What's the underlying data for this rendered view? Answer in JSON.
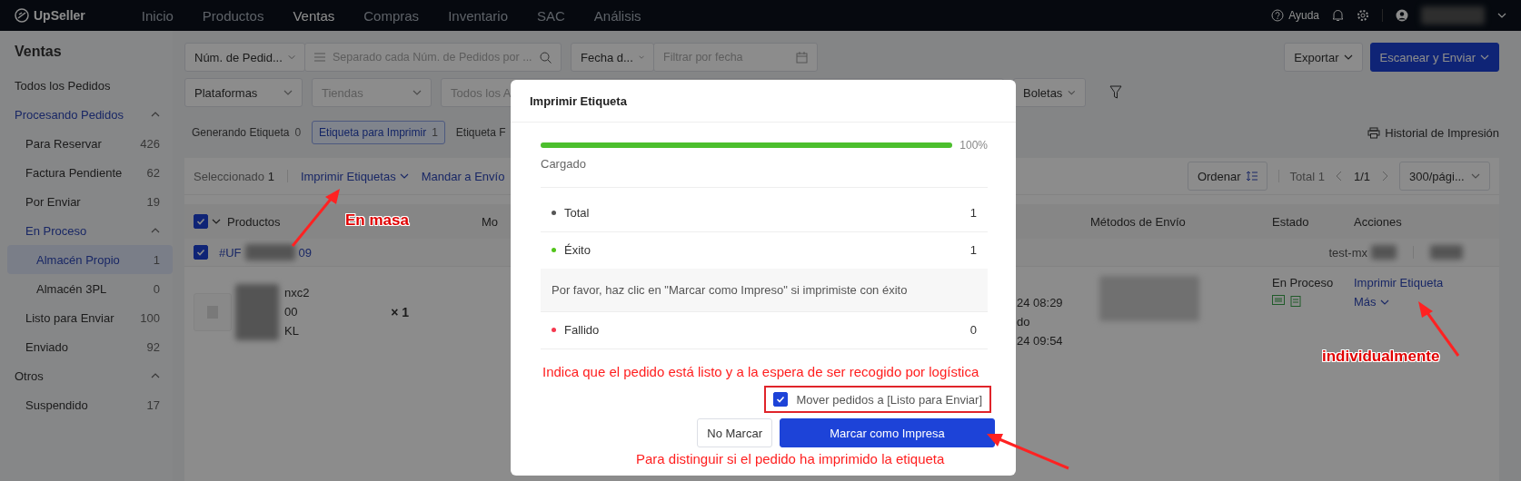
{
  "top_nav": {
    "logo": "UpSeller",
    "items": [
      {
        "label": "Inicio",
        "selected": false
      },
      {
        "label": "Productos",
        "selected": false
      },
      {
        "label": "Ventas",
        "selected": true
      },
      {
        "label": "Compras",
        "selected": false
      },
      {
        "label": "Inventario",
        "selected": false
      },
      {
        "label": "SAC",
        "selected": false
      },
      {
        "label": "Análisis",
        "selected": false
      }
    ],
    "help": "Ayuda"
  },
  "sidebar": {
    "title": "Ventas",
    "items": [
      {
        "label": "Todos los Pedidos",
        "selected": false
      },
      {
        "label": "Procesando Pedidos",
        "selected": false,
        "expanded": true,
        "children": [
          {
            "label": "Para Reservar",
            "count": "426",
            "selected": false
          },
          {
            "label": "Factura Pendiente",
            "count": "62",
            "selected": false
          },
          {
            "label": "Por Enviar",
            "count": "19",
            "selected": false
          },
          {
            "label": "En Proceso",
            "selected": false,
            "expanded": true,
            "children": [
              {
                "label": "Almacén Propio",
                "count": "1",
                "selected": true
              },
              {
                "label": "Almacén 3PL",
                "count": "0",
                "selected": false
              }
            ]
          },
          {
            "label": "Listo para Enviar",
            "count": "100",
            "selected": false
          },
          {
            "label": "Enviado",
            "count": "92",
            "selected": false
          }
        ]
      },
      {
        "label": "Otros",
        "selected": false,
        "expanded": true,
        "children": [
          {
            "label": "Suspendido",
            "count": "17",
            "selected": false
          }
        ]
      }
    ]
  },
  "filters": {
    "order_field": "Núm. de Pedid...",
    "search_placeholder": "Separado cada Núm. de Pedidos por ...",
    "date_field": "Fecha d...",
    "date_placeholder": "Filtrar por fecha",
    "platforms": "Plataformas",
    "stores": "Tiendas",
    "all_field": "Todos los A",
    "receipts": "Boletas"
  },
  "actions": {
    "export": "Exportar",
    "scan": "Escanear y Enviar"
  },
  "status_tabs": [
    {
      "label": "Generando Etiqueta",
      "count": "0",
      "selected": false
    },
    {
      "label": "Etiqueta para Imprimir",
      "count": "1",
      "selected": true
    },
    {
      "label": "Etiqueta F",
      "selected": false
    }
  ],
  "print_history": "Historial de Impresión",
  "toolbar": {
    "selected_label": "Seleccionado",
    "selected_count": "1",
    "bulk_actions": [
      "Imprimir Etiquetas",
      "Mandar a Envío"
    ],
    "sort": "Ordenar",
    "total": "Total 1",
    "page": "1/1",
    "page_size": "300/pági..."
  },
  "table": {
    "header_checked": true,
    "columns": [
      "Productos",
      "Mo",
      "Métodos de Envío",
      "Estado",
      "Acciones"
    ],
    "order": {
      "checked": true,
      "id_start": "#UF",
      "id_end": "09",
      "store": "test-mx"
    },
    "item": {
      "lines": [
        "nxc2",
        "00",
        "KL"
      ],
      "quantity": "× 1",
      "dates": [
        "24 08:29",
        "do",
        "24 09:54"
      ],
      "status": "En Proceso",
      "actions": [
        "Imprimir Etiqueta",
        "Más"
      ]
    }
  },
  "modal": {
    "title": "Imprimir Etiqueta",
    "level": 1,
    "percent": "100%",
    "progress_label": "Cargado",
    "rows": [
      {
        "kind": "result",
        "label": "Total",
        "value": "1",
        "color": "#555555"
      },
      {
        "kind": "result",
        "label": "Éxito",
        "value": "1",
        "color": "#52c41a"
      },
      {
        "kind": "notice",
        "label": "Por favor, haz clic en \"Marcar como Impreso\" si imprimiste con éxito"
      },
      {
        "kind": "result",
        "label": "Fallido",
        "value": "0",
        "color": "#f5384e"
      }
    ],
    "checkbox": {
      "label": "Mover pedidos a [Listo para Enviar]",
      "checked": true
    },
    "buttons": [
      {
        "label": "No Marcar",
        "kind": "secondary"
      },
      {
        "label": "Marcar como Impresa",
        "kind": "primary"
      }
    ]
  },
  "annotations": [
    "En masa",
    "individualmente",
    "Indica que el pedido está listo y a la espera de ser recogido por logística",
    "Para distinguir si el pedido ha imprimido la etiqueta"
  ]
}
